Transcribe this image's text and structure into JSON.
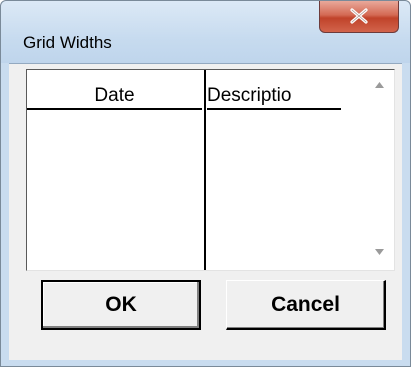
{
  "window": {
    "title": "Grid Widths"
  },
  "title_bar": {
    "close_icon": "close-x-icon"
  },
  "grid": {
    "columns": [
      {
        "header": "Date"
      },
      {
        "header": "Descriptio"
      }
    ],
    "rows": [],
    "scrollbar": {
      "up_icon": "scroll-up-arrow-icon",
      "down_icon": "scroll-down-arrow-icon"
    }
  },
  "buttons": {
    "ok_label": "OK",
    "cancel_label": "Cancel"
  },
  "colors": {
    "frame": "#c9dcef",
    "client": "#f0f0f0",
    "close_button": "#c8472f"
  }
}
